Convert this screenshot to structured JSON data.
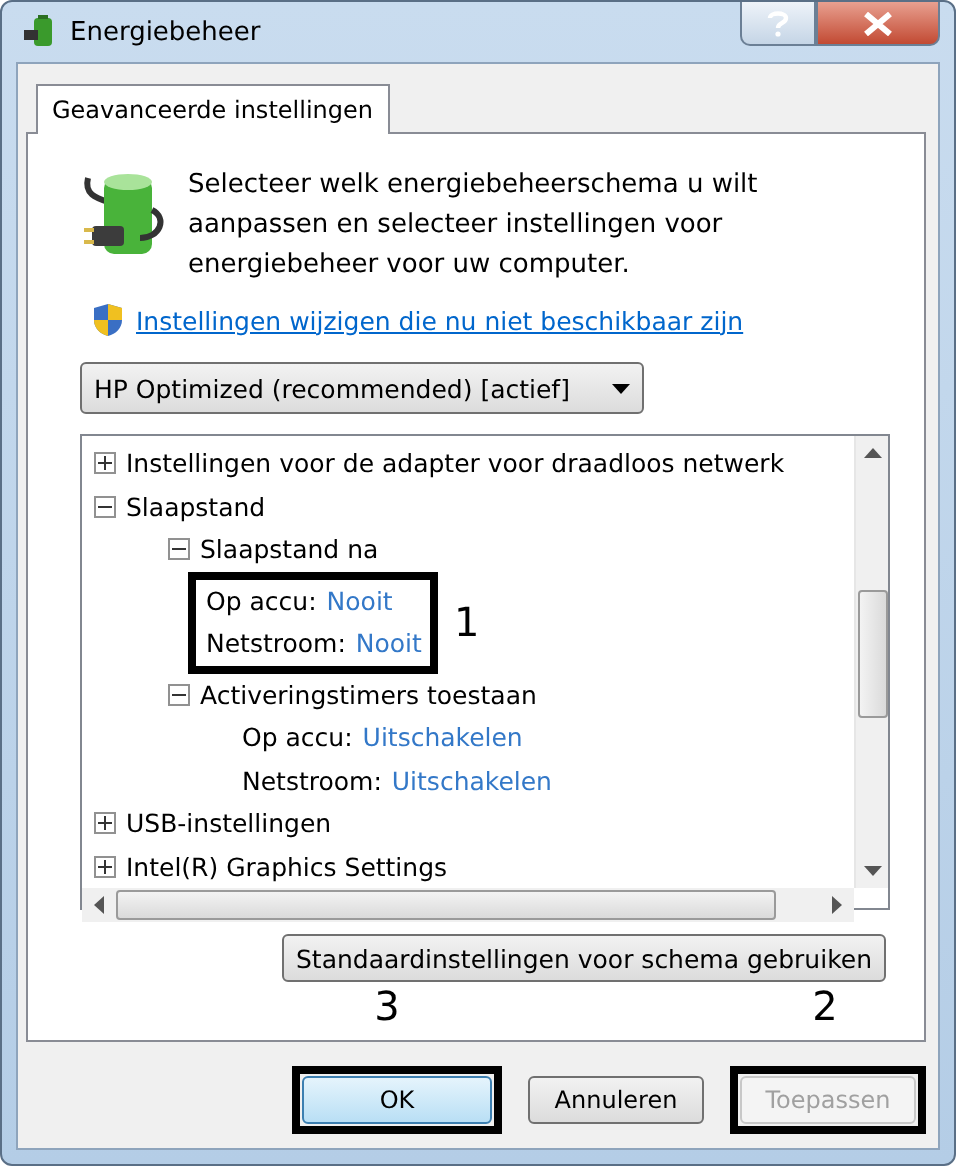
{
  "window": {
    "title": "Energiebeheer"
  },
  "tabs": [
    {
      "label": "Geavanceerde instellingen",
      "selected": true
    }
  ],
  "intro": "Selecteer welk energiebeheerschema u wilt aanpassen en selecteer instellingen voor energiebeheer voor uw computer.",
  "link": "Instellingen wijzigen die nu niet beschikbaar zijn",
  "plan_select": {
    "value": "HP Optimized (recommended) [actief]"
  },
  "tree": [
    {
      "label": "Instellingen voor de adapter voor draadloos netwerk",
      "expanded": false
    },
    {
      "label": "Slaapstand",
      "expanded": true,
      "children": [
        {
          "label": "Slaapstand na",
          "expanded": true,
          "callout": "1",
          "children": [
            {
              "label": "Op accu:",
              "value": "Nooit"
            },
            {
              "label": "Netstroom:",
              "value": "Nooit"
            }
          ]
        },
        {
          "label": "Activeringstimers toestaan",
          "expanded": true,
          "children": [
            {
              "label": "Op accu:",
              "value": "Uitschakelen"
            },
            {
              "label": "Netstroom:",
              "value": "Uitschakelen"
            }
          ]
        }
      ]
    },
    {
      "label": "USB-instellingen",
      "expanded": false
    },
    {
      "label": "Intel(R) Graphics Settings",
      "expanded": false
    }
  ],
  "restore_button": "Standaardinstellingen voor schema gebruiken",
  "buttons": [
    {
      "label": "OK",
      "default": true,
      "disabled": false,
      "callout": "3"
    },
    {
      "label": "Annuleren",
      "default": false,
      "disabled": false
    },
    {
      "label": "Toepassen",
      "default": false,
      "disabled": true,
      "callout": "2"
    }
  ]
}
